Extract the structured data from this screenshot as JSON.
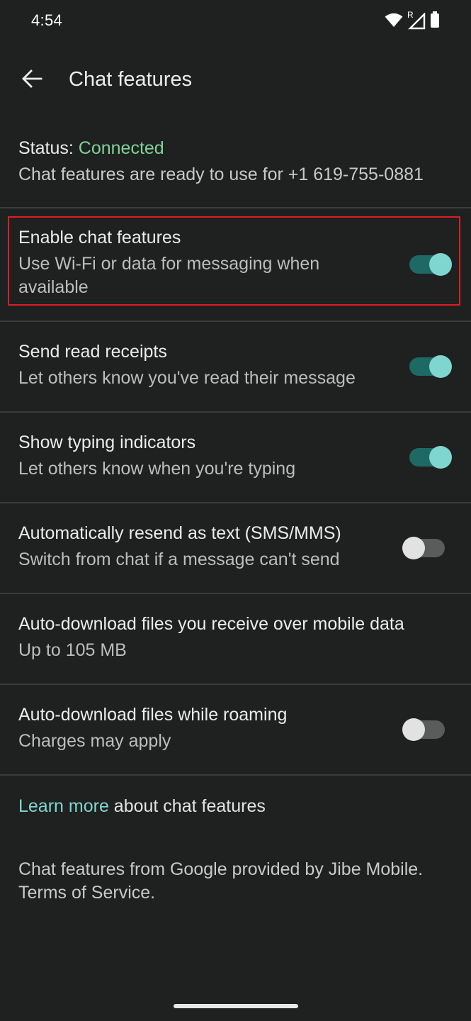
{
  "status_bar": {
    "time": "4:54",
    "icons": [
      "wifi-icon",
      "signal-roaming-icon",
      "battery-icon"
    ],
    "roaming_indicator": "R"
  },
  "app_bar": {
    "back_icon": "arrow-back-icon",
    "title": "Chat features"
  },
  "status_section": {
    "label": "Status:",
    "value": "Connected",
    "description": "Chat features are ready to use for +1 619-755-0881"
  },
  "settings": [
    {
      "title": "Enable chat features",
      "subtitle": "Use Wi-Fi or data for messaging when available",
      "toggle": "on",
      "highlighted": true
    },
    {
      "title": "Send read receipts",
      "subtitle": "Let others know you've read their message",
      "toggle": "on"
    },
    {
      "title": "Show typing indicators",
      "subtitle": "Let others know when you're typing",
      "toggle": "on"
    },
    {
      "title": "Automatically resend as text (SMS/MMS)",
      "subtitle": "Switch from chat if a message can't send",
      "toggle": "off"
    },
    {
      "title": "Auto-download files you receive over mobile data",
      "subtitle": "Up to 105 MB",
      "toggle": null
    },
    {
      "title": "Auto-download files while roaming",
      "subtitle": "Charges may apply",
      "toggle": "off"
    }
  ],
  "footer": {
    "learn_more_link": "Learn more",
    "learn_more_rest": " about chat features",
    "provider_text": "Chat features from Google provided by Jibe Mobile.",
    "terms_link": "Terms of Service."
  },
  "colors": {
    "background": "#1f2020",
    "accent": "#7fd6d0",
    "connected": "#7fd39a",
    "highlight_border": "#e01b24"
  }
}
